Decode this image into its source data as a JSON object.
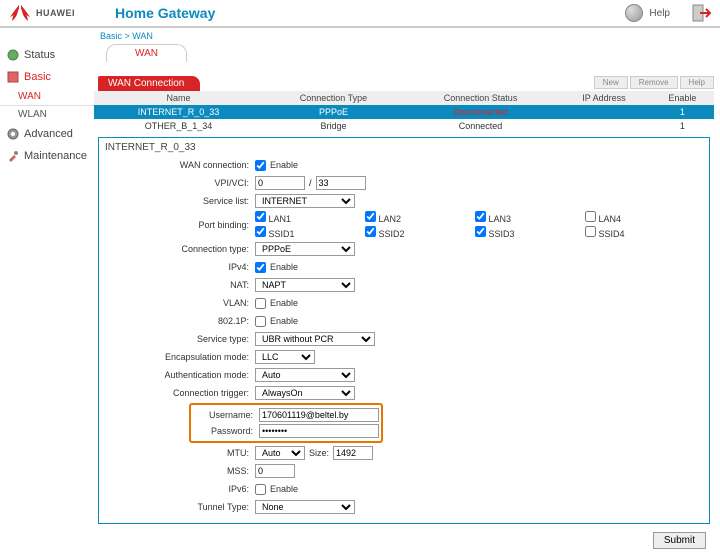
{
  "top": {
    "brand": "HUAWEI",
    "title": "Home Gateway",
    "help": "Help"
  },
  "breadcrumb": "Basic > WAN",
  "nav": {
    "status": "Status",
    "basic": "Basic",
    "wan": "WAN",
    "wlan": "WLAN",
    "advanced": "Advanced",
    "maintenance": "Maintenance"
  },
  "tab": {
    "wan": "WAN"
  },
  "section": "WAN Connection",
  "actions": {
    "new": "New",
    "remove": "Remove",
    "help": "Help"
  },
  "thead": {
    "name": "Name",
    "type": "Connection Type",
    "status": "Connection Status",
    "ip": "IP Address",
    "enable": "Enable"
  },
  "rows": [
    {
      "name": "INTERNET_R_0_33",
      "type": "PPPoE",
      "status": "Disconnected",
      "ip": "",
      "enable": "1"
    },
    {
      "name": "OTHER_B_1_34",
      "type": "Bridge",
      "status": "Connected",
      "ip": "",
      "enable": "1"
    }
  ],
  "panel": {
    "title": "INTERNET_R_0_33",
    "labels": {
      "wanconn": "WAN connection:",
      "enable": "Enable",
      "vpivci": "VPI/VCI:",
      "vpi": "0",
      "vci": "33",
      "servicelist": "Service list:",
      "servicelist_v": "INTERNET",
      "portbind": "Port binding:",
      "ports": {
        "lan1": "LAN1",
        "lan2": "LAN2",
        "lan3": "LAN3",
        "lan4": "LAN4",
        "ssid1": "SSID1",
        "ssid2": "SSID2",
        "ssid3": "SSID3",
        "ssid4": "SSID4"
      },
      "conntype": "Connection type:",
      "conntype_v": "PPPoE",
      "ipv4": "IPv4:",
      "nat": "NAT:",
      "nat_v": "NAPT",
      "vlan": "VLAN:",
      "dot1p": "802.1P:",
      "servtype": "Service type:",
      "servtype_v": "UBR without PCR",
      "encap": "Encapsulation mode:",
      "encap_v": "LLC",
      "auth": "Authentication mode:",
      "auth_v": "Auto",
      "trigger": "Connection trigger:",
      "trigger_v": "AlwaysOn",
      "user": "Username:",
      "user_v": "170601119@beltel.by",
      "pass": "Password:",
      "pass_v": "••••••••",
      "mtu": "MTU:",
      "mtu_v": "Auto",
      "size": "Size:",
      "size_v": "1492",
      "mss": "MSS:",
      "mss_v": "0",
      "ipv6": "IPv6:",
      "tunnel": "Tunnel Type:",
      "tunnel_v": "None"
    }
  },
  "submit": "Submit"
}
